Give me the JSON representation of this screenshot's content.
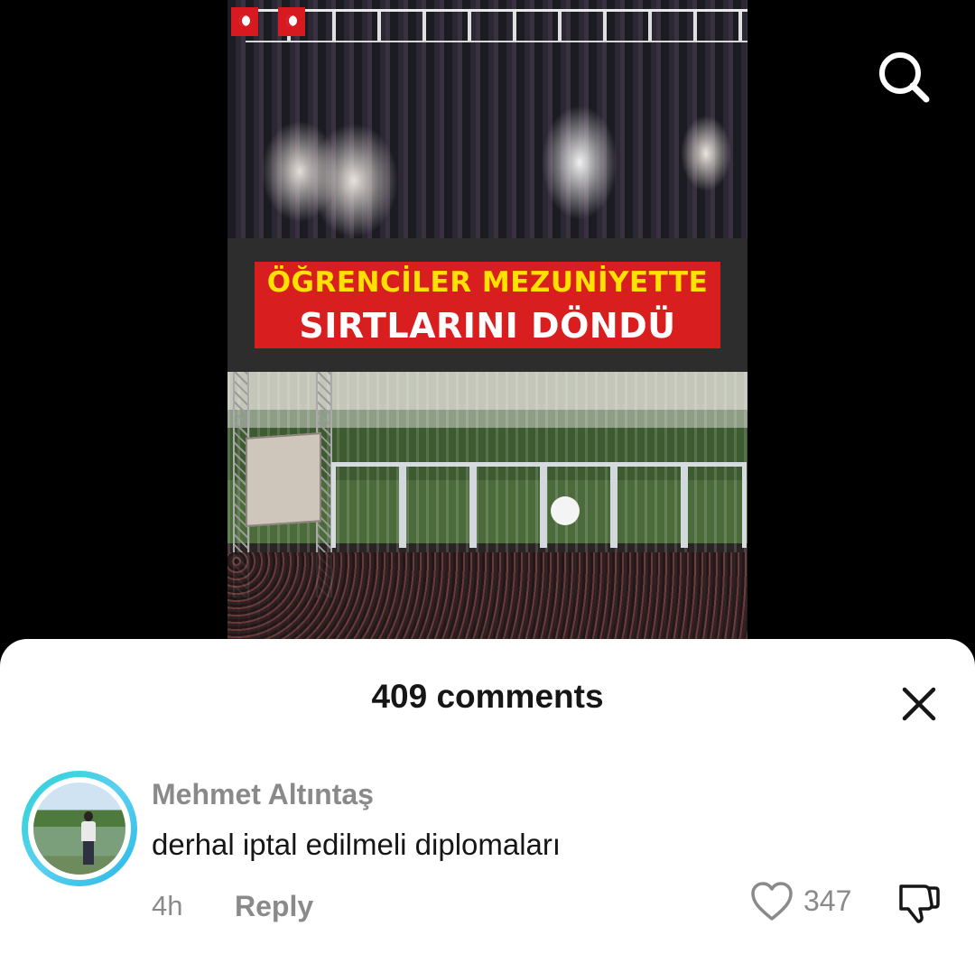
{
  "video": {
    "headline_line1": "ÖĞRENCİLER MEZUNİYETTE",
    "headline_line2": "SIRTLARINI DÖNDÜ"
  },
  "top_bar": {
    "search_icon": "search-icon"
  },
  "comments": {
    "title": "409 comments",
    "close_icon": "close-icon",
    "items": [
      {
        "author": "Mehmet Altıntaş",
        "text": "derhal iptal edilmeli diplomaları",
        "time": "4h",
        "reply_label": "Reply",
        "like_count": "347",
        "like_icon": "heart-outline-icon",
        "dislike_icon": "thumbs-down-icon"
      }
    ]
  },
  "colors": {
    "headline_red": "#d81e1e",
    "headline_yellow": "#ffe200",
    "avatar_ring": "#2bd3d3",
    "muted_text": "#8a8a8a",
    "primary_text": "#161616"
  }
}
